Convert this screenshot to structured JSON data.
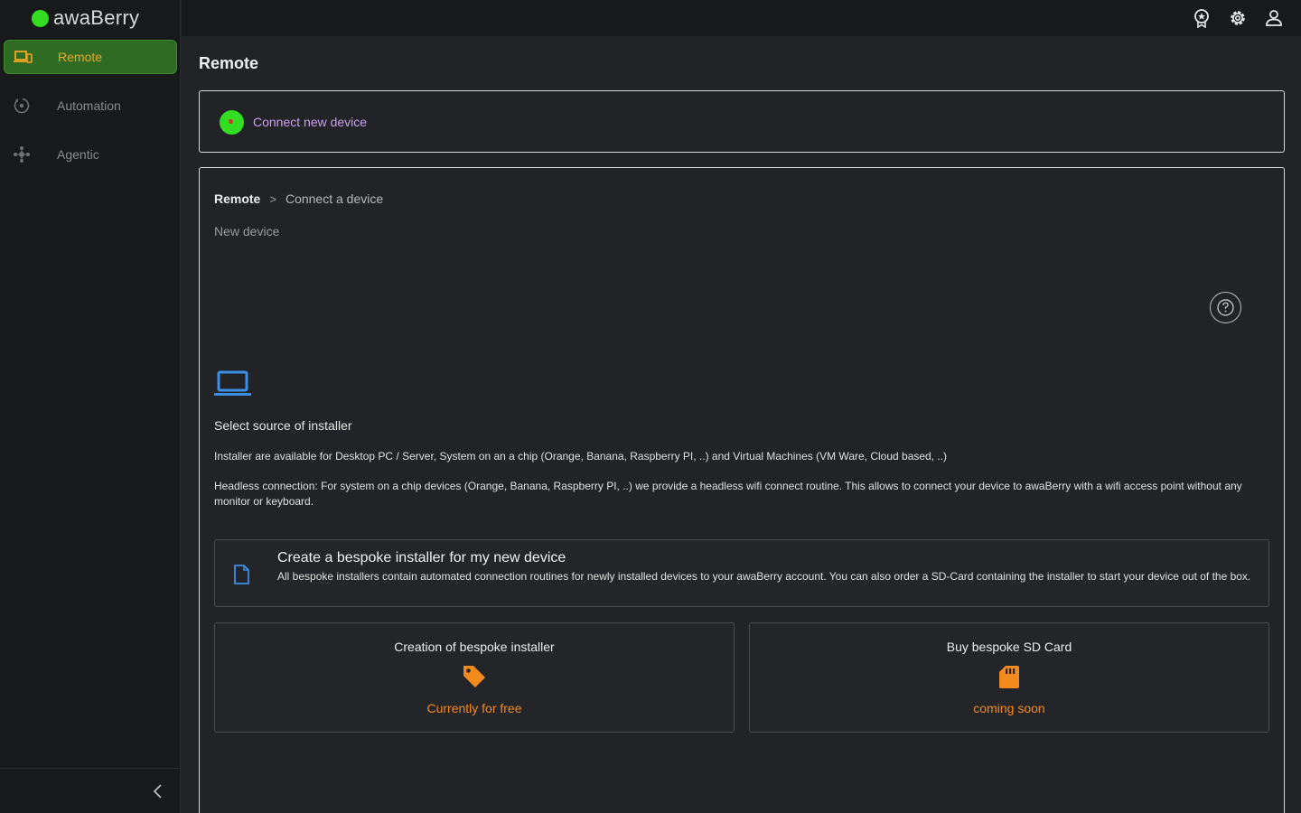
{
  "brand": {
    "name": "awaBerry",
    "color": "#33dd22"
  },
  "sidebar": {
    "items": [
      {
        "label": "Remote",
        "icon": "devices-icon",
        "active": true
      },
      {
        "label": "Automation",
        "icon": "automation-icon",
        "active": false
      },
      {
        "label": "Agentic",
        "icon": "agentic-icon",
        "active": false
      }
    ]
  },
  "topbar": {
    "icons": [
      "award-icon",
      "gear-icon",
      "user-icon"
    ]
  },
  "page": {
    "title": "Remote"
  },
  "connect": {
    "label": "Connect new device"
  },
  "breadcrumb": {
    "root": "Remote",
    "separator": ">",
    "current": "Connect a device"
  },
  "main": {
    "subtitle": "New device",
    "section_title": "Select source of installer",
    "para1": "Installer are available for Desktop PC / Server, System on an a chip (Orange, Banana, Raspberry PI, ..) and  Virtual Machines (VM Ware, Cloud based, ..)",
    "para2": "Headless connection: For system on a chip devices (Orange, Banana, Raspberry PI, ..) we provide a headless wifi connect routine. This allows to connect your device to awaBerry with a wifi access point without any monitor or keyboard."
  },
  "bespoke": {
    "title": "Create a bespoke installer for my new device",
    "description": "All bespoke installers contain automated connection routines for newly installed devices to your awaBerry account. You can also order a SD-Card containing the installer to start your device out of the box."
  },
  "options": [
    {
      "title": "Creation of bespoke installer",
      "icon": "tag-icon",
      "value": "Currently for free"
    },
    {
      "title": "Buy bespoke SD Card",
      "icon": "sd-card-icon",
      "value": "coming soon"
    }
  ],
  "colors": {
    "accent": "#f28a1e",
    "active_bg": "#2f6b22",
    "link": "#c9a0f0",
    "icon_blue": "#3a8ee6"
  }
}
